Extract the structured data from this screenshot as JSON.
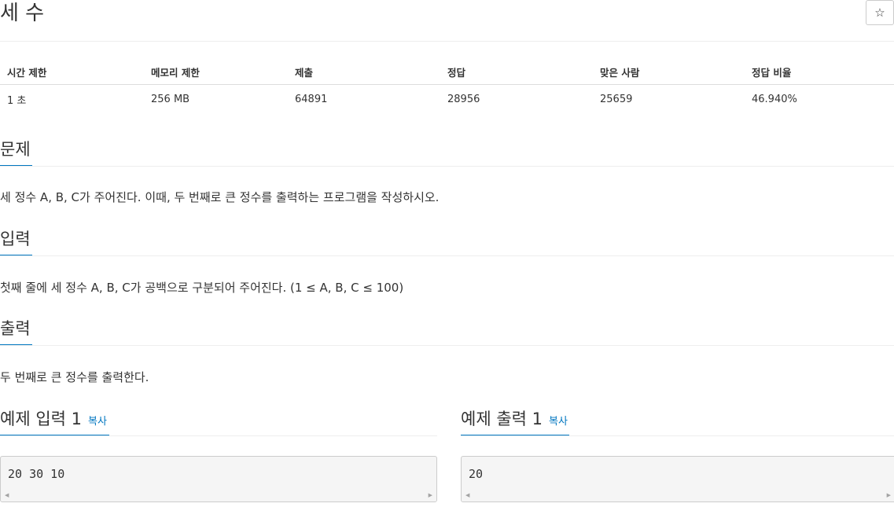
{
  "problem": {
    "title": "세 수",
    "star_label": "☆"
  },
  "info_table": {
    "headers": [
      "시간 제한",
      "메모리 제한",
      "제출",
      "정답",
      "맞은 사람",
      "정답 비율"
    ],
    "values": [
      "1 초",
      "256 MB",
      "64891",
      "28956",
      "25659",
      "46.940%"
    ]
  },
  "sections": {
    "description": {
      "heading": "문제",
      "body": "세 정수 A, B, C가 주어진다. 이때, 두 번째로 큰 정수를 출력하는 프로그램을 작성하시오."
    },
    "input": {
      "heading": "입력",
      "body": "첫째 줄에 세 정수 A, B, C가 공백으로 구분되어 주어진다. (1 ≤ A, B, C ≤ 100)"
    },
    "output": {
      "heading": "출력",
      "body": "두 번째로 큰 정수를 출력한다."
    }
  },
  "samples": {
    "input": {
      "heading": "예제 입력 1",
      "copy_label": "복사",
      "content": "20 30 10"
    },
    "output": {
      "heading": "예제 출력 1",
      "copy_label": "복사",
      "content": "20"
    }
  },
  "scroll_icons": {
    "left": "◀",
    "right": "▶"
  },
  "colors": {
    "accent": "#0076c0",
    "sample_bg": "#f5f5f5",
    "border": "#cccccc"
  }
}
